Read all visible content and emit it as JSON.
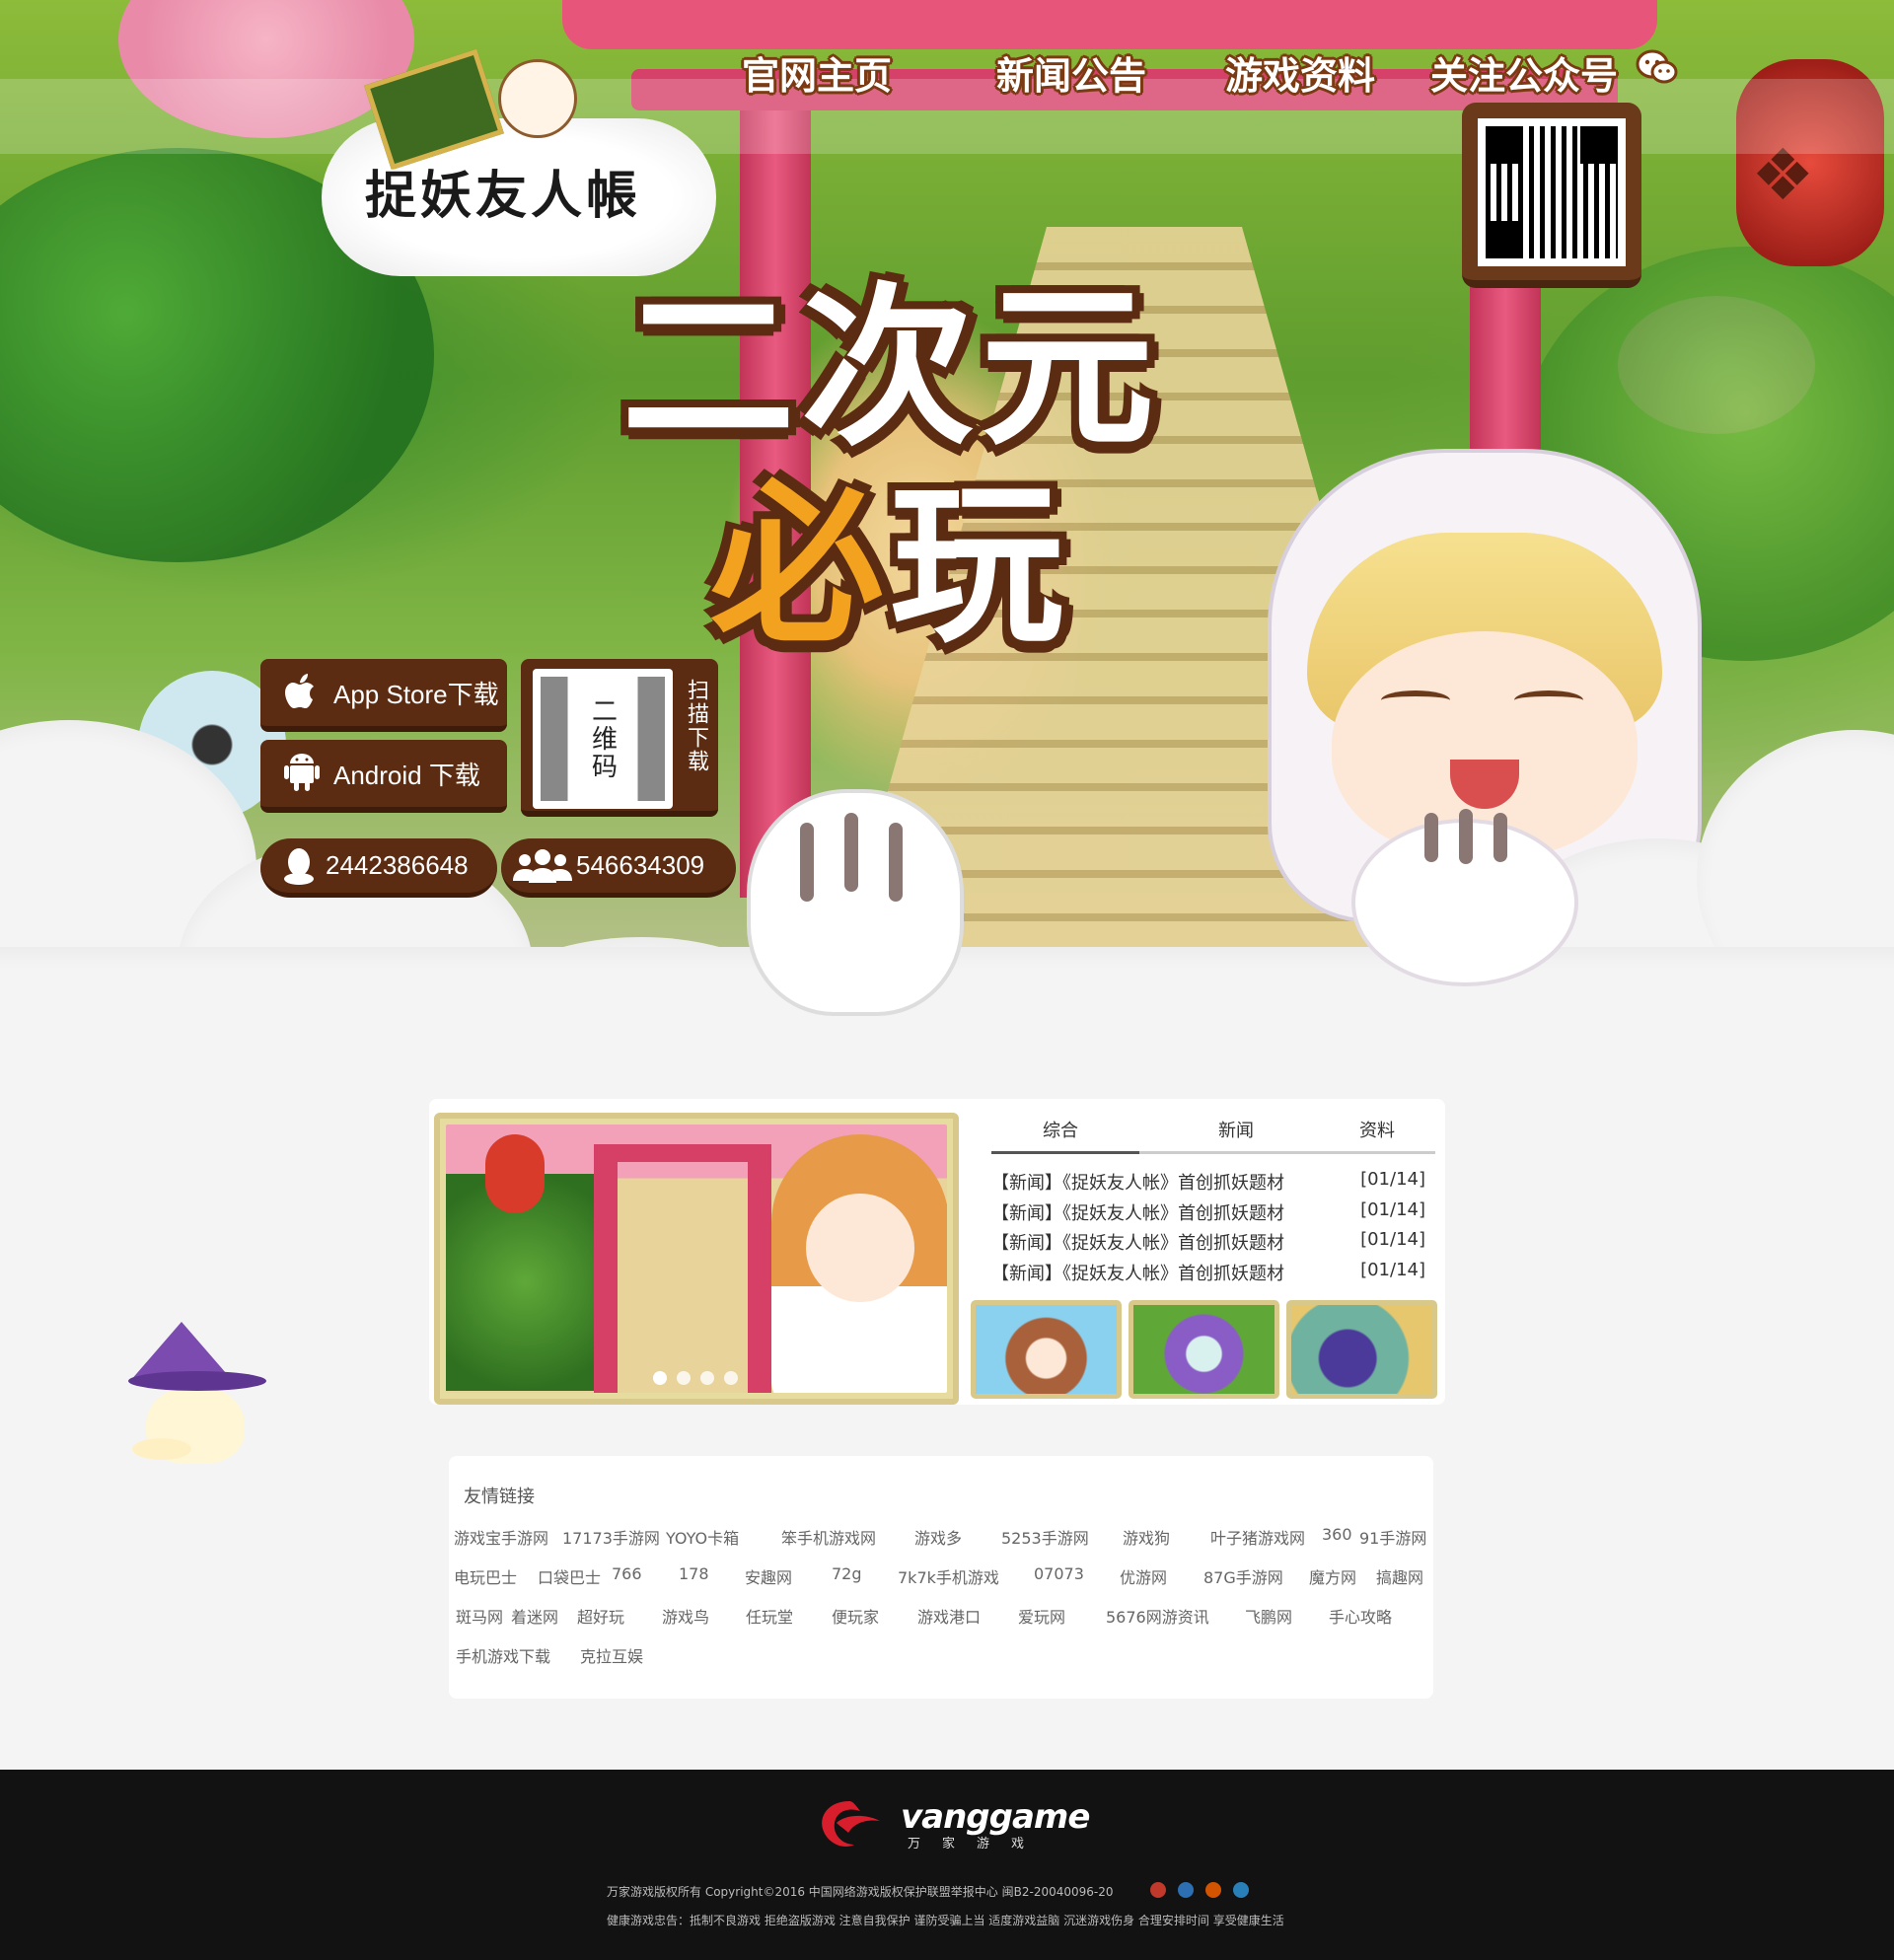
{
  "nav": {
    "items": [
      {
        "label": "官网主页"
      },
      {
        "label": "新闻公告"
      },
      {
        "label": "游戏资料"
      },
      {
        "label": "关注公众号"
      }
    ]
  },
  "logo": {
    "text": "捉妖友人帳",
    "scroll_text": "友人帳"
  },
  "slogan": {
    "line1": "二次元",
    "line2_accent": "必",
    "line2": "玩"
  },
  "download": {
    "appstore_label": "App Store下载",
    "android_label": "Android 下载",
    "qr_label": "二维码",
    "scan_label": "扫描下载",
    "qq_number": "2442386648",
    "group_number": "546634309"
  },
  "news": {
    "tabs": [
      {
        "label": "综合"
      },
      {
        "label": "新闻"
      },
      {
        "label": "资料"
      }
    ],
    "active_tab": "综合",
    "items": [
      {
        "title": "【新闻】《捉妖友人帐》首创抓妖题材",
        "date": "[01/14]"
      },
      {
        "title": "【新闻】《捉妖友人帐》首创抓妖题材",
        "date": "[01/14]"
      },
      {
        "title": "【新闻】《捉妖友人帐》首创抓妖题材",
        "date": "[01/14]"
      },
      {
        "title": "【新闻】《捉妖友人帐》首创抓妖题材",
        "date": "[01/14]"
      }
    ],
    "slider_dots": 4,
    "active_dot": 0
  },
  "links": {
    "title": "友情链接",
    "rows": [
      [
        "游戏宝手游网",
        "17173手游网",
        "YOYO卡箱",
        "笨手机游戏网",
        "游戏多",
        "5253手游网",
        "游戏狗",
        "叶子猪游戏网",
        "360",
        "91手游网"
      ],
      [
        "电玩巴士",
        "口袋巴士",
        "766",
        "178",
        "安趣网",
        "72g",
        "7k7k手机游戏",
        "07073",
        "优游网",
        "87G手游网",
        "魔方网",
        "搞趣网"
      ],
      [
        "斑马网",
        "着迷网",
        "超好玩",
        "游戏鸟",
        "任玩堂",
        "便玩家",
        "游戏港口",
        "爱玩网",
        "5676网游资讯",
        "飞鹏网",
        "手心攻略"
      ],
      [
        "手机游戏下载",
        "克拉互娱"
      ]
    ]
  },
  "footer": {
    "brand": "vanggame",
    "brand_sub": "万家游戏",
    "copyright": "万家游戏版权所有 Copyright©2016 中国网络游戏版权保护联盟举报中心 闽B2-20040096-20",
    "warning": "健康游戏忠告：抵制不良游戏 拒绝盗版游戏 注意自我保护 谨防受骗上当 适度游戏益脑 沉迷游戏伤身 合理安排时间 享受健康生活"
  },
  "colors": {
    "button_brown": "#5c2c12",
    "nav_outline": "#7b3a12",
    "accent_orange": "#f2a21f",
    "footer_bg": "#121212",
    "page_bg": "#f4f4f4"
  },
  "icons": [
    "apple-icon",
    "android-icon",
    "qq-icon",
    "group-icon",
    "wechat-icon"
  ]
}
